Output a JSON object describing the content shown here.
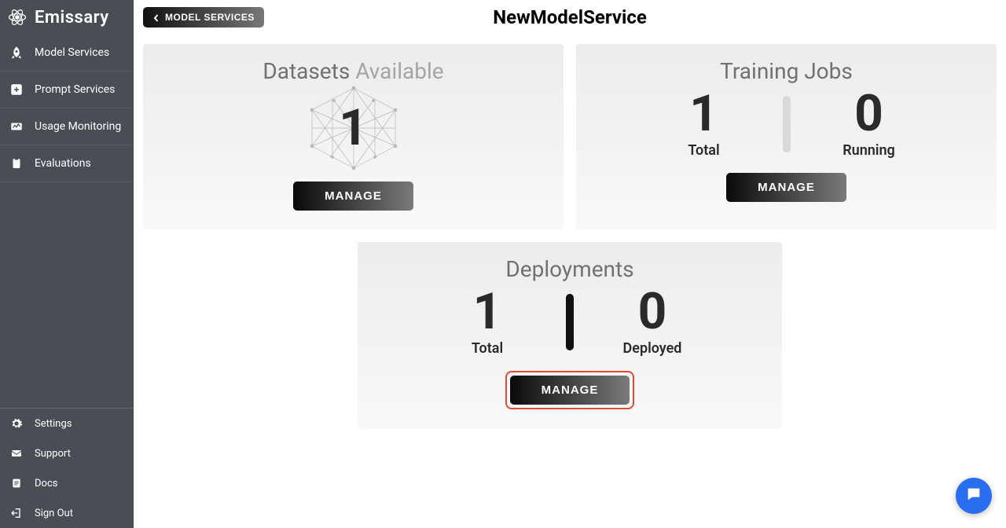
{
  "brand": "Emissary",
  "sidebar": {
    "primary": [
      {
        "label": "Model Services",
        "icon": "rocket"
      },
      {
        "label": "Prompt Services",
        "icon": "plus-box"
      },
      {
        "label": "Usage Monitoring",
        "icon": "monitor"
      },
      {
        "label": "Evaluations",
        "icon": "clipboard"
      }
    ],
    "secondary": [
      {
        "label": "Settings",
        "icon": "gear"
      },
      {
        "label": "Support",
        "icon": "mail"
      },
      {
        "label": "Docs",
        "icon": "doc"
      },
      {
        "label": "Sign Out",
        "icon": "signout"
      }
    ]
  },
  "back_button": "MODEL SERVICES",
  "page_title": "NewModelService",
  "cards": {
    "datasets": {
      "title_a": "Datasets ",
      "title_b": "Available",
      "value": "1",
      "manage": "MANAGE"
    },
    "training": {
      "title": "Training Jobs",
      "total_value": "1",
      "total_label": "Total",
      "running_value": "0",
      "running_label": "Running",
      "manage": "MANAGE"
    },
    "deployments": {
      "title": "Deployments",
      "total_value": "1",
      "total_label": "Total",
      "deployed_value": "0",
      "deployed_label": "Deployed",
      "manage": "MANAGE"
    }
  }
}
